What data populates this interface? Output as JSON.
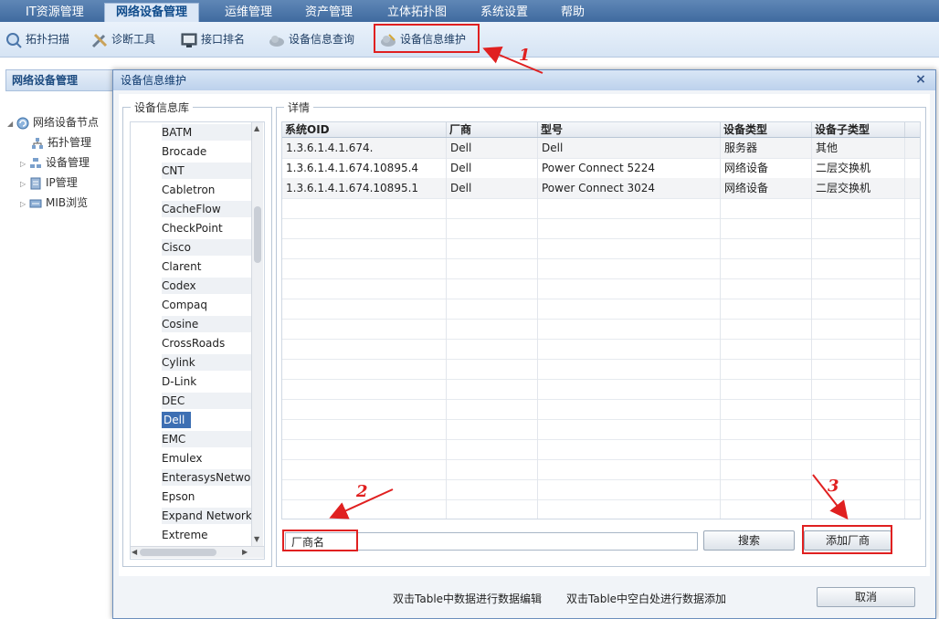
{
  "menu": {
    "items": [
      "IT资源管理",
      "网络设备管理",
      "运维管理",
      "资产管理",
      "立体拓扑图",
      "系统设置",
      "帮助"
    ],
    "active_index": 1
  },
  "toolbar": {
    "items": [
      "拓扑扫描",
      "诊断工具",
      "接口排名",
      "设备信息查询",
      "设备信息维护"
    ],
    "icons": [
      "scan-icon",
      "tools-icon",
      "monitor-icon",
      "cloud-search-icon",
      "cloud-edit-icon"
    ]
  },
  "left_panel": {
    "title": "网络设备管理",
    "tree": {
      "root": "网络设备节点",
      "children": [
        "拓扑管理",
        "设备管理",
        "IP管理",
        "MIB浏览"
      ]
    }
  },
  "dialog": {
    "title": "设备信息维护",
    "close": "×",
    "vendor_group": {
      "legend": "设备信息库",
      "vendors": [
        "BATM",
        "Brocade",
        "CNT",
        "Cabletron",
        "CacheFlow",
        "CheckPoint",
        "Cisco",
        "Clarent",
        "Codex",
        "Compaq",
        "Cosine",
        "CrossRoads",
        "Cylink",
        "D-Link",
        "DEC",
        "Dell",
        "EMC",
        "Emulex",
        "EnterasysNetwo",
        "Epson",
        "Expand Network",
        "Extreme"
      ],
      "selected": "Dell"
    },
    "detail_group": {
      "legend": "详情",
      "columns": [
        "系统OID",
        "厂商",
        "型号",
        "设备类型",
        "设备子类型"
      ],
      "rows": [
        [
          "1.3.6.1.4.1.674.",
          "Dell",
          "Dell",
          "服务器",
          "其他"
        ],
        [
          "1.3.6.1.4.1.674.10895.4",
          "Dell",
          "Power Connect 5224",
          "网络设备",
          "二层交换机"
        ],
        [
          "1.3.6.1.4.1.674.10895.1",
          "Dell",
          "Power Connect 3024",
          "网络设备",
          "二层交换机"
        ]
      ],
      "empty_rows": 16,
      "vendor_input_value": "厂商名",
      "search_label": "搜索",
      "add_vendor_label": "添加厂商"
    },
    "footer": {
      "hint_edit": "双击Table中数据进行数据编辑",
      "hint_add": "双击Table中空白处进行数据添加",
      "cancel_label": "取消"
    }
  },
  "annotations": [
    "1",
    "2",
    "3"
  ],
  "colors": {
    "annotation_red": "#e02020",
    "menubar_blue": "#4a74a8",
    "selection_blue": "#3d6fb3"
  }
}
